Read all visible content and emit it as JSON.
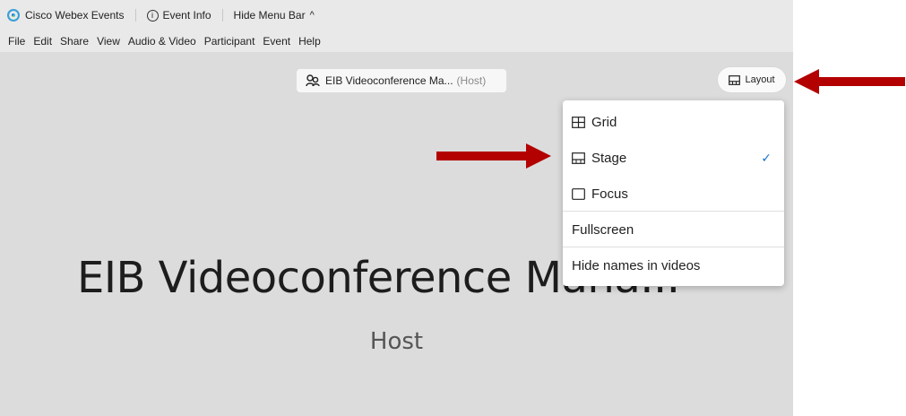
{
  "titlebar": {
    "app_name": "Cisco Webex Events",
    "event_info_label": "Event Info",
    "hide_menu_bar_label": "Hide Menu Bar",
    "info_glyph": "i",
    "chevron_glyph": "^"
  },
  "menubar": {
    "items": [
      "File",
      "Edit",
      "Share",
      "View",
      "Audio & Video",
      "Participant",
      "Event",
      "Help"
    ]
  },
  "stage": {
    "host_chip": {
      "name": "EIB Videoconference Ma...",
      "role": "(Host)"
    },
    "layout_button_label": "Layout",
    "big_name": "EIB Videoconference Mana...",
    "big_role": "Host"
  },
  "layout_menu": {
    "items": [
      {
        "label": "Grid",
        "icon": "grid-icon",
        "selected": false
      },
      {
        "label": "Stage",
        "icon": "stage-layout-icon",
        "selected": true
      },
      {
        "label": "Focus",
        "icon": "focus-icon",
        "selected": false
      },
      {
        "label": "Fullscreen"
      },
      {
        "label": "Hide names in videos"
      }
    ],
    "check_glyph": "✓"
  },
  "colors": {
    "stage_bg": "#dcdcdc",
    "bar_bg": "#e9e9e9",
    "annotation_arrow": "#b30000",
    "check": "#1d75c9"
  }
}
